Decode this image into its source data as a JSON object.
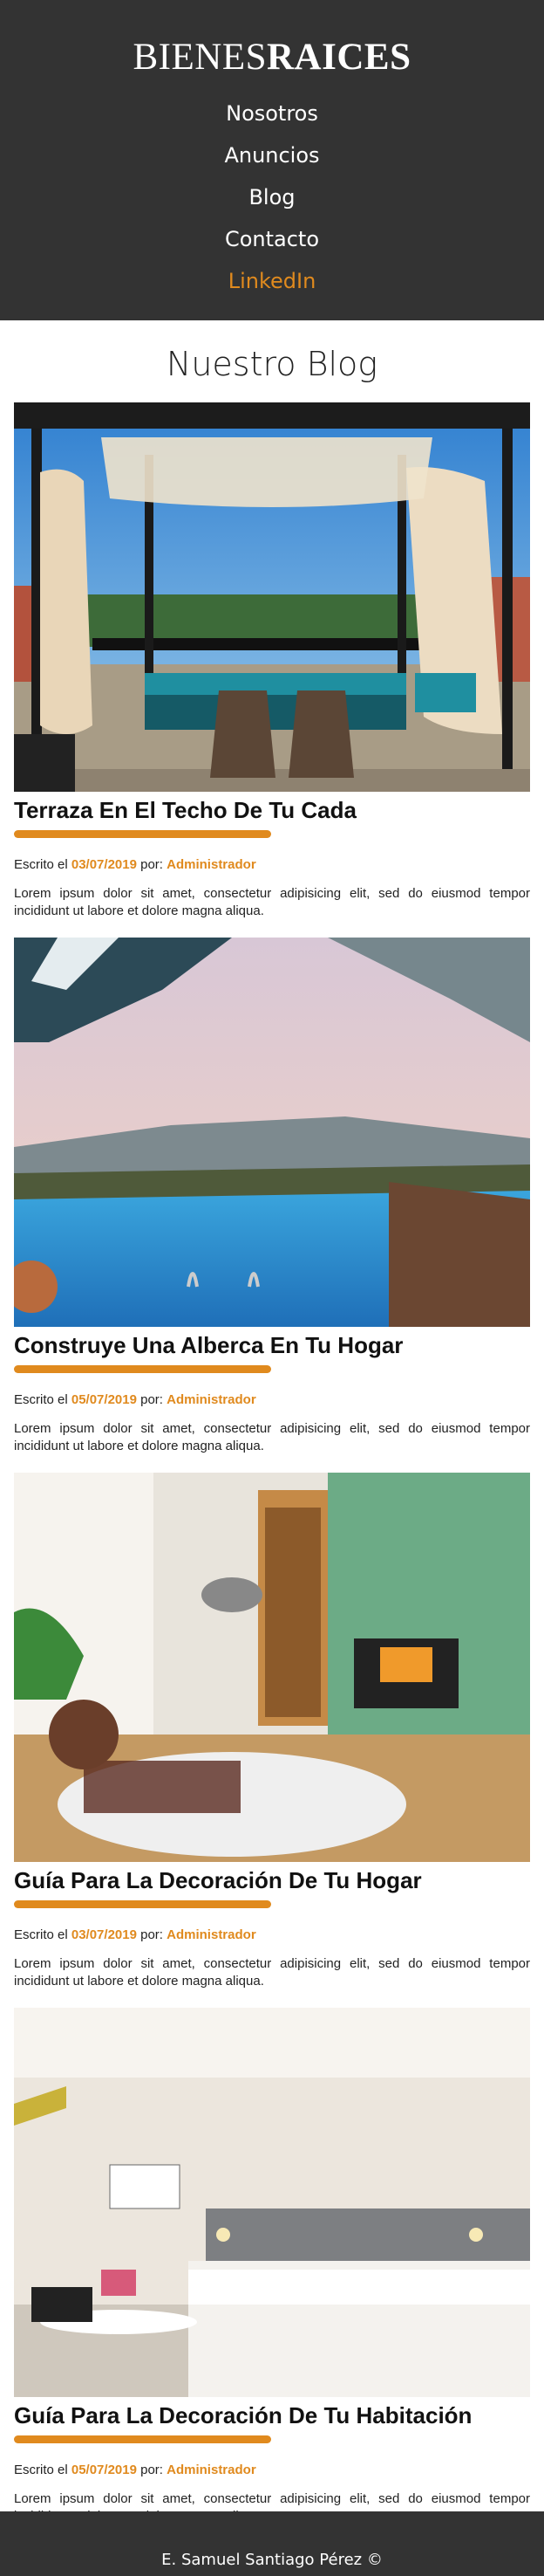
{
  "header": {
    "logo_normal": "BIENES",
    "logo_bold": "RAICES",
    "nav": [
      {
        "label": "Nosotros"
      },
      {
        "label": "Anuncios"
      },
      {
        "label": "Blog"
      },
      {
        "label": "Contacto"
      },
      {
        "label": "LinkedIn"
      }
    ]
  },
  "main": {
    "title": "Nuestro Blog",
    "entries": [
      {
        "title": "Terraza En El Techo De Tu Cada",
        "written_prefix": "Escrito el",
        "date": "03/07/2019",
        "by_prefix": "por:",
        "author": "Administrador",
        "excerpt": "Lorem ipsum dolor sit amet, consectetur adipisicing elit, sed do eiusmod tempor incididunt ut labore et dolore magna aliqua."
      },
      {
        "title": "Construye Una Alberca En Tu Hogar",
        "written_prefix": "Escrito el",
        "date": "05/07/2019",
        "by_prefix": "por:",
        "author": "Administrador",
        "excerpt": "Lorem ipsum dolor sit amet, consectetur adipisicing elit, sed do eiusmod tempor incididunt ut labore et dolore magna aliqua."
      },
      {
        "title": "Guía Para La Decoración De Tu Hogar",
        "written_prefix": "Escrito el",
        "date": "03/07/2019",
        "by_prefix": "por:",
        "author": "Administrador",
        "excerpt": "Lorem ipsum dolor sit amet, consectetur adipisicing elit, sed do eiusmod tempor incididunt ut labore et dolore magna aliqua."
      },
      {
        "title": "Guía Para La Decoración De Tu Habitación",
        "written_prefix": "Escrito el",
        "date": "05/07/2019",
        "by_prefix": "por:",
        "author": "Administrador",
        "excerpt": "Lorem ipsum dolor sit amet, consectetur adipisicing elit, sed do eiusmod tempor incididunt ut labore et dolore magna aliqua."
      }
    ]
  },
  "footer": {
    "text": "E. Samuel Santiago Pérez ©"
  },
  "colors": {
    "accent": "#e08a1e",
    "dark_bg": "#333333"
  }
}
